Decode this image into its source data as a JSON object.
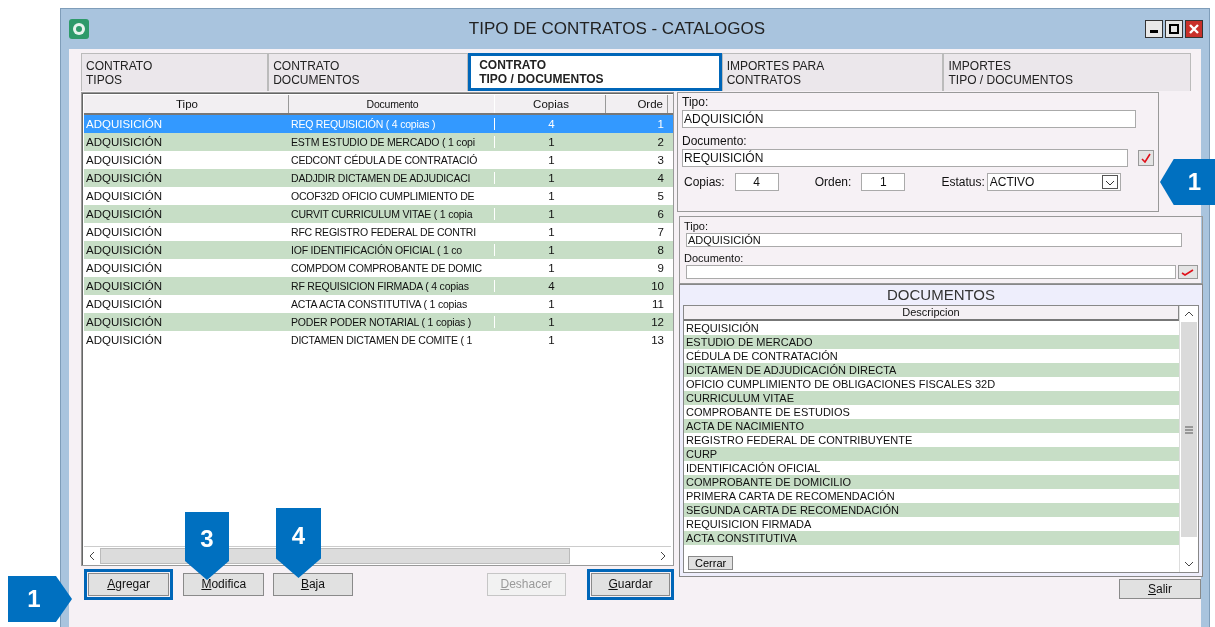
{
  "window": {
    "title": "TIPO DE CONTRATOS - CATALOGOS"
  },
  "tabs": [
    {
      "lines": [
        "CONTRATO",
        "TIPOS"
      ],
      "selected": false,
      "highlighted": false
    },
    {
      "lines": [
        "CONTRATO",
        "DOCUMENTOS"
      ],
      "selected": false,
      "highlighted": false
    },
    {
      "lines": [
        "CONTRATO",
        "TIPO / DOCUMENTOS"
      ],
      "selected": true,
      "highlighted": true
    },
    {
      "lines": [
        "IMPORTES PARA",
        "CONTRATOS"
      ],
      "selected": false,
      "highlighted": false
    },
    {
      "lines": [
        "IMPORTES",
        "TIPO / DOCUMENTOS"
      ],
      "selected": false,
      "highlighted": false
    }
  ],
  "table": {
    "columns": [
      "Tipo",
      "Documento",
      "Copias",
      "Orde"
    ],
    "rows": [
      {
        "cells": [
          "ADQUISICIÓN",
          "REQ REQUISICIÓN ( 4 copias )",
          "4",
          "1"
        ],
        "selected": true
      },
      {
        "cells": [
          "ADQUISICIÓN",
          "ESTM ESTUDIO DE MERCADO ( 1 copi",
          "1",
          "2"
        ],
        "selected": false
      },
      {
        "cells": [
          "ADQUISICIÓN",
          "CEDCONT CÉDULA DE CONTRATACIÓ",
          "1",
          "3"
        ],
        "selected": false
      },
      {
        "cells": [
          "ADQUISICIÓN",
          "DADJDIR DICTAMEN DE ADJUDICACI",
          "1",
          "4"
        ],
        "selected": false
      },
      {
        "cells": [
          "ADQUISICIÓN",
          "OCOF32D OFICIO CUMPLIMIENTO DE",
          "1",
          "5"
        ],
        "selected": false
      },
      {
        "cells": [
          "ADQUISICIÓN",
          "CURVIT CURRICULUM VITAE ( 1 copia",
          "1",
          "6"
        ],
        "selected": false
      },
      {
        "cells": [
          "ADQUISICIÓN",
          "RFC REGISTRO FEDERAL DE CONTRI",
          "1",
          "7"
        ],
        "selected": false
      },
      {
        "cells": [
          "ADQUISICIÓN",
          "IOF IDENTIFICACIÓN OFICIAL ( 1 co",
          "1",
          "8"
        ],
        "selected": false
      },
      {
        "cells": [
          "ADQUISICIÓN",
          "COMPDOM COMPROBANTE DE DOMIC",
          "1",
          "9"
        ],
        "selected": false
      },
      {
        "cells": [
          "ADQUISICIÓN",
          "RF REQUISICION FIRMADA ( 4 copias",
          "4",
          "10"
        ],
        "selected": false
      },
      {
        "cells": [
          "ADQUISICIÓN",
          "ACTA ACTA CONSTITUTIVA ( 1 copias",
          "1",
          "11"
        ],
        "selected": false
      },
      {
        "cells": [
          "ADQUISICIÓN",
          "PODER PODER NOTARIAL ( 1 copias )",
          "1",
          "12"
        ],
        "selected": false
      },
      {
        "cells": [
          "ADQUISICIÓN",
          "DICTAMEN DICTAMEN DE COMITE ( 1",
          "1",
          "13"
        ],
        "selected": false
      }
    ]
  },
  "form": {
    "tipo_label": "Tipo:",
    "tipo_value": "ADQUISICIÓN",
    "documento_label": "Documento:",
    "documento_value": "REQUISICIÓN",
    "copias_label": "Copias:",
    "copias_value": "4",
    "orden_label": "Orden:",
    "orden_value": "1",
    "estatus_label": "Estatus:",
    "estatus_value": "ACTIVO"
  },
  "search_panel": {
    "tipo_label": "Tipo:",
    "tipo_value": "ADQUISICIÓN",
    "documento_label": "Documento:"
  },
  "documents": {
    "title": "DOCUMENTOS",
    "column": "Descripcion",
    "items": [
      "REQUISICIÓN",
      "ESTUDIO DE MERCADO",
      "CÉDULA DE CONTRATACIÓN",
      "DICTAMEN DE ADJUDICACIÓN DIRECTA",
      "OFICIO CUMPLIMIENTO DE OBLIGACIONES FISCALES 32D",
      "CURRICULUM VITAE",
      "COMPROBANTE DE ESTUDIOS",
      "ACTA DE NACIMIENTO",
      "REGISTRO FEDERAL DE CONTRIBUYENTE",
      "CURP",
      "IDENTIFICACIÓN OFICIAL",
      "COMPROBANTE DE DOMICILIO",
      "PRIMERA CARTA DE RECOMENDACIÓN",
      "SEGUNDA CARTA DE RECOMENDACIÓN",
      "REQUISICION FIRMADA",
      "ACTA CONSTITUTIVA"
    ],
    "close_button": "Cerrar"
  },
  "buttons": [
    {
      "label": "Agregar",
      "disabled": false,
      "highlighted": true
    },
    {
      "label": "Modifica",
      "disabled": false,
      "highlighted": false
    },
    {
      "label": "Baja",
      "disabled": false,
      "highlighted": false
    },
    {
      "label": "Deshacer",
      "disabled": true,
      "highlighted": false
    },
    {
      "label": "Guardar",
      "disabled": false,
      "highlighted": true
    }
  ],
  "exit_button": "Salir",
  "callouts": [
    {
      "label": "1",
      "kind": "left"
    },
    {
      "label": "1",
      "kind": "right"
    },
    {
      "label": "3",
      "kind": "down"
    },
    {
      "label": "4",
      "kind": "down"
    }
  ]
}
